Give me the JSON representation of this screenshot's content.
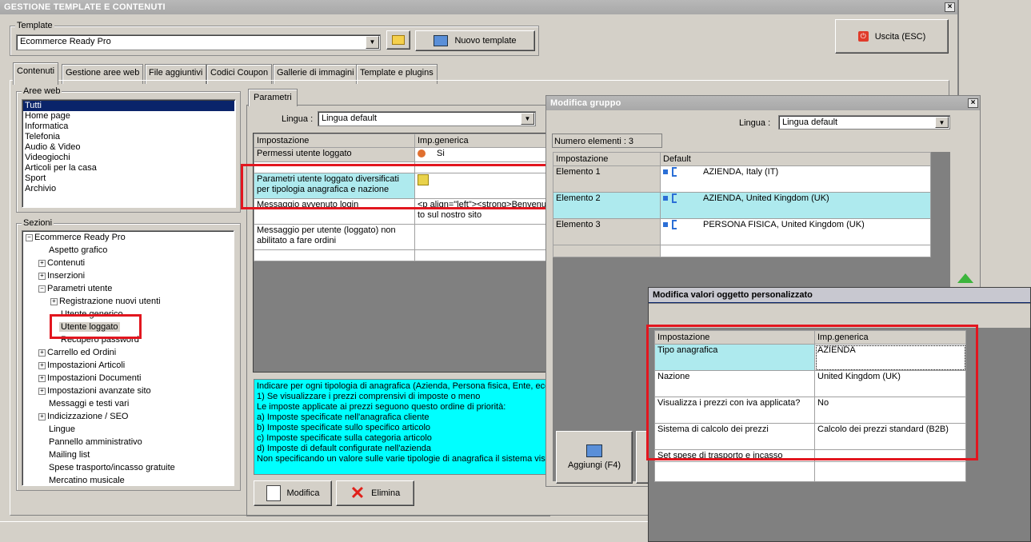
{
  "window": {
    "title": "GESTIONE TEMPLATE E CONTENUTI",
    "close": "×"
  },
  "template": {
    "group_label": "Template",
    "selected": "Ecommerce Ready Pro",
    "new_button": "Nuovo template",
    "exit_button": "Uscita (ESC)"
  },
  "tabs": [
    "Contenuti",
    "Gestione aree web",
    "File aggiuntivi",
    "Codici Coupon",
    "Gallerie di immagini",
    "Template e plugins"
  ],
  "aree_web": {
    "label": "Aree web",
    "items": [
      "Tutti",
      "Home page",
      "Informatica",
      "Telefonia",
      "Audio & Video",
      "Videogiochi",
      "Articoli per la casa",
      "Sport",
      "Archivio"
    ]
  },
  "sezioni": {
    "label": "Sezioni",
    "items": [
      {
        "label": "Ecommerce Ready Pro",
        "exp": "⊟"
      },
      {
        "label": "Aspetto grafico",
        "exp": ""
      },
      {
        "label": "Contenuti",
        "exp": "⊞"
      },
      {
        "label": "Inserzioni",
        "exp": "⊞"
      },
      {
        "label": "Parametri utente",
        "exp": "⊟"
      },
      {
        "label": "Registrazione nuovi utenti",
        "exp": "⊞"
      },
      {
        "label": "Utente generico",
        "exp": ""
      },
      {
        "label": "Utente loggato",
        "exp": ""
      },
      {
        "label": "Recupero password",
        "exp": ""
      },
      {
        "label": "Carrello ed Ordini",
        "exp": "⊞"
      },
      {
        "label": "Impostazioni Articoli",
        "exp": "⊞"
      },
      {
        "label": "Impostazioni Documenti",
        "exp": "⊞"
      },
      {
        "label": "Impostazioni avanzate sito",
        "exp": "⊞"
      },
      {
        "label": "Messaggi e testi vari",
        "exp": ""
      },
      {
        "label": "Indicizzazione / SEO",
        "exp": "⊞"
      },
      {
        "label": "Lingue",
        "exp": ""
      },
      {
        "label": "Pannello amministrativo",
        "exp": ""
      },
      {
        "label": "Mailing list",
        "exp": ""
      },
      {
        "label": "Spese trasporto/incasso gratuite",
        "exp": ""
      },
      {
        "label": "Mercatino musicale",
        "exp": ""
      }
    ]
  },
  "parametri": {
    "tab": "Parametri",
    "lingua_label": "Lingua :",
    "lingua_value": "Lingua default",
    "headers": [
      "Impostazione",
      "Imp.generica"
    ],
    "rows": [
      {
        "name": "Permessi utente loggato",
        "value": "Si"
      },
      {
        "name": "",
        "value": ""
      },
      {
        "name": "Parametri utente loggato diversificati per tipologia anagrafica e nazione",
        "value": ""
      },
      {
        "name": "Messaggio avvenuto login",
        "value": "<p align=\"left\"><strong>Benvenuto sul nostro sito"
      },
      {
        "name": "Messaggio per utente (loggato) non abilitato a fare ordini",
        "value": ""
      }
    ],
    "info_lines": [
      "Indicare per ogni tipologia di anagrafica (Azienda, Persona fisica, Ente, ecc.",
      "1) Se visualizzare i prezzi comprensivi di imposte o meno",
      "Le imposte applicate ai prezzi seguono questo ordine di priorità:",
      "a) Imposte specificate nell'anagrafica cliente",
      "b) Imposte specificate sullo specifico articolo",
      "c) Imposte specificate sulla categoria articolo",
      "d) Imposte di default configurate nell'azienda",
      "Non specificando un valore sulle varie tipologie di anagrafica il sistema visua"
    ],
    "modifica_button": "Modifica",
    "elimina_button": "Elimina"
  },
  "modifica_gruppo": {
    "title": "Modifica gruppo",
    "lingua_label": "Lingua :",
    "lingua_value": "Lingua default",
    "count_label": "Numero elementi : 3",
    "headers": [
      "Impostazione",
      "Default"
    ],
    "rows": [
      {
        "name": "Elemento 1",
        "value": "AZIENDA, Italy (IT)"
      },
      {
        "name": "Elemento 2",
        "value": "AZIENDA, United Kingdom (UK)"
      },
      {
        "name": "Elemento 3",
        "value": "PERSONA FISICA, United Kingdom (UK)"
      }
    ],
    "aggiungi_button": "Aggiungi (F4)"
  },
  "modifica_valori": {
    "title": "Modifica valori oggetto personalizzato",
    "headers": [
      "Impostazione",
      "Imp.generica"
    ],
    "rows": [
      {
        "name": "Tipo anagrafica",
        "value": "AZIENDA"
      },
      {
        "name": "Nazione",
        "value": "United Kingdom (UK)"
      },
      {
        "name": "Visualizza i prezzi con iva applicata?",
        "value": "No"
      },
      {
        "name": "Sistema di calcolo dei prezzi",
        "value": "Calcolo dei prezzi standard (B2B)"
      },
      {
        "name": "Set spese di trasporto e incasso",
        "value": ""
      }
    ]
  },
  "colors": {
    "highlight_red": "#e2161f",
    "cyan": "#aeeaee",
    "info_bg": "#00ffff",
    "selection": "#0a246a"
  }
}
